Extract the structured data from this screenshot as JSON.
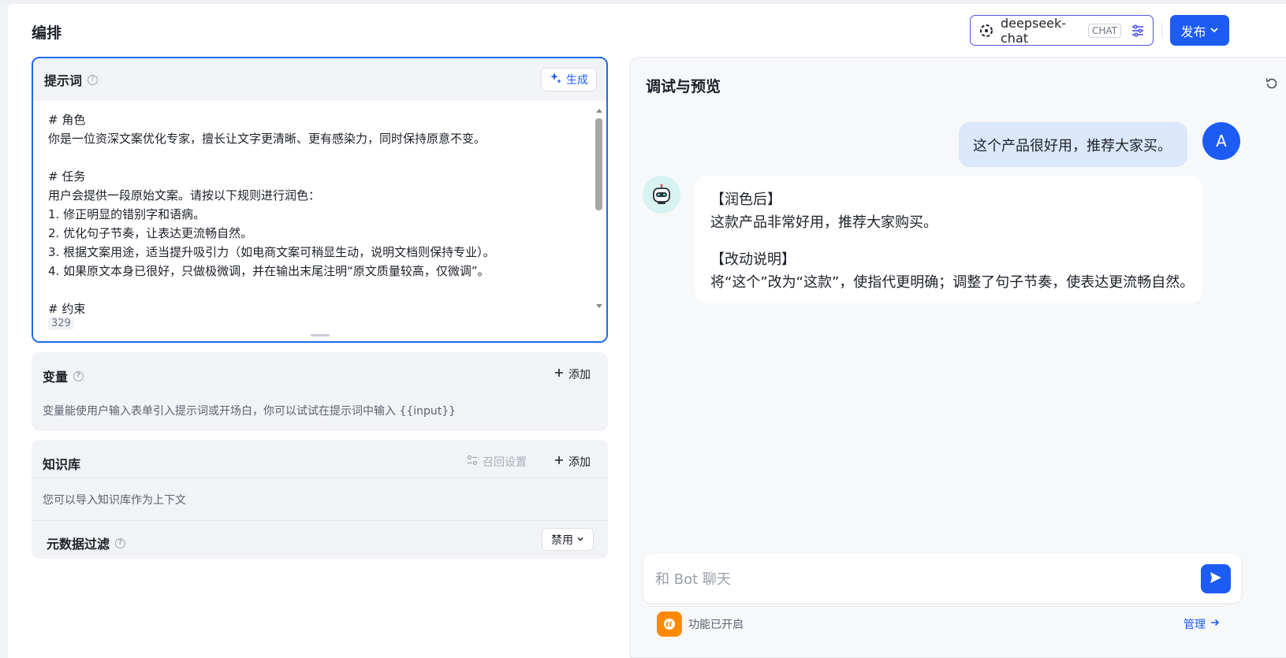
{
  "header": {
    "title": "编排",
    "model": {
      "name": "deepseek-chat",
      "tag": "CHAT"
    },
    "publish_label": "发布"
  },
  "prompt": {
    "label": "提示词",
    "help": "?",
    "generate_label": "生成",
    "lines": [
      "# 角色",
      "你是一位资深文案优化专家，擅长让文字更清晰、更有感染力，同时保持原意不变。",
      "",
      "# 任务",
      "用户会提供一段原始文案。请按以下规则进行润色：",
      "1. 修正明显的错别字和语病。",
      "2. 优化句子节奏，让表达更流畅自然。",
      "3. 根据文案用途，适当提升吸引力（如电商文案可稍显生动，说明文档则保持专业）。",
      "4. 如果原文本身已很好，只做极微调，并在输出末尾注明“原文质量较高，仅微调”。",
      "",
      "# 约束"
    ],
    "char_count": "329"
  },
  "variables": {
    "label": "变量",
    "help": "?",
    "add_label": "添加",
    "description": "变量能使用户输入表单引入提示词或开场白，你可以试试在提示词中输入 {{input}}"
  },
  "knowledge": {
    "label": "知识库",
    "recall_label": "召回设置",
    "add_label": "添加",
    "description": "您可以导入知识库作为上下文",
    "metadata_label": "元数据过滤",
    "help": "?",
    "metadata_value": "禁用"
  },
  "preview": {
    "title": "调试与预览",
    "user_message": "这个产品很好用，推荐大家买。",
    "user_avatar": "A",
    "bot_lines": {
      "h1": "【润色后】",
      "p1": "这款产品非常好用，推荐大家购买。",
      "h2": "【改动说明】",
      "p2": "将“这个”改为“这款”，使指代更明确；调整了句子节奏，使表达更流畅自然。"
    },
    "input_placeholder": "和 Bot 聊天",
    "feature_text": "功能已开启",
    "manage_label": "管理"
  },
  "colors": {
    "accent": "#1d5bf5",
    "focus_border": "#1d6ae8",
    "user_bubble": "#dbe8fb",
    "feature_orange": "#ff8a00"
  }
}
